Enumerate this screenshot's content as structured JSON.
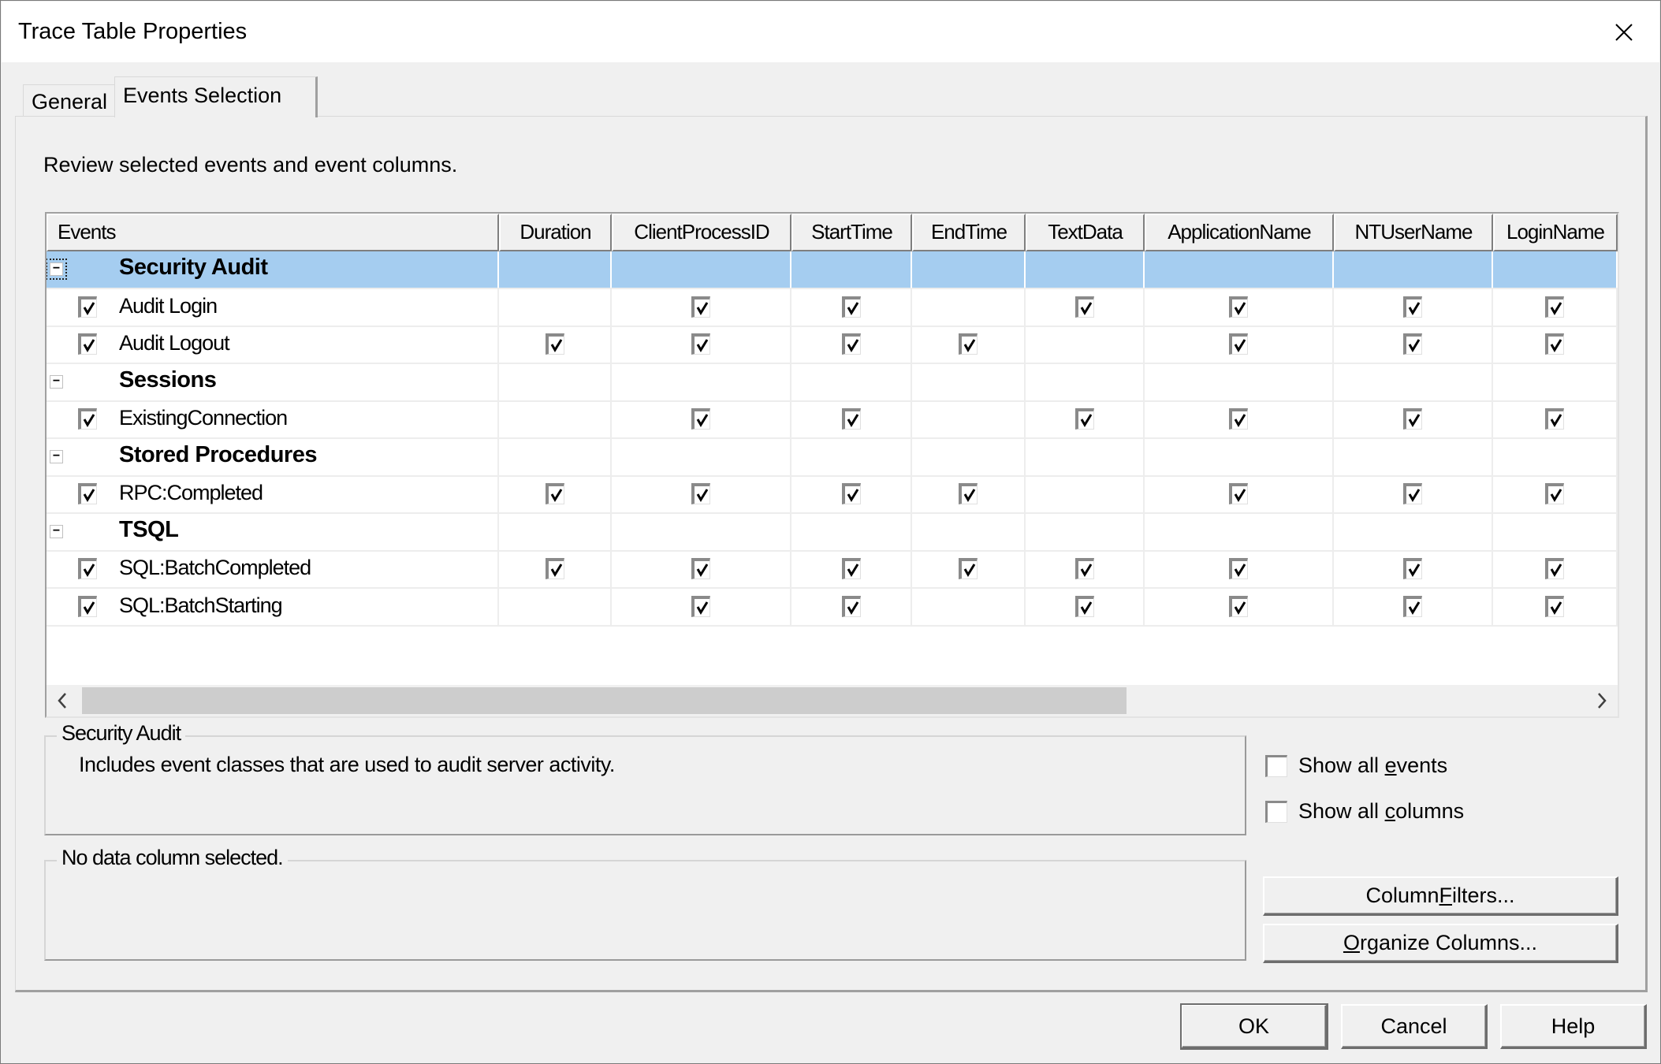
{
  "window": {
    "title": "Trace Table Properties",
    "close_icon": "close-x"
  },
  "tabs": [
    {
      "label": "General",
      "active": false
    },
    {
      "label": "Events Selection",
      "active": true
    }
  ],
  "instruction": "Review selected events and event columns.",
  "grid": {
    "columns": [
      "Events",
      "Duration",
      "ClientProcessID",
      "StartTime",
      "EndTime",
      "TextData",
      "ApplicationName",
      "NTUserName",
      "LoginName"
    ],
    "rows": [
      {
        "type": "category",
        "label": "Security Audit",
        "expanded": true,
        "selected": true
      },
      {
        "type": "event",
        "label": "Audit Login",
        "checked": true,
        "cols": [
          false,
          true,
          true,
          false,
          true,
          true,
          true,
          true
        ]
      },
      {
        "type": "event",
        "label": "Audit Logout",
        "checked": true,
        "cols": [
          true,
          true,
          true,
          true,
          false,
          true,
          true,
          true
        ]
      },
      {
        "type": "category",
        "label": "Sessions",
        "expanded": true,
        "selected": false
      },
      {
        "type": "event",
        "label": "ExistingConnection",
        "checked": true,
        "cols": [
          false,
          true,
          true,
          false,
          true,
          true,
          true,
          true
        ]
      },
      {
        "type": "category",
        "label": "Stored Procedures",
        "expanded": true,
        "selected": false
      },
      {
        "type": "event",
        "label": "RPC:Completed",
        "checked": true,
        "cols": [
          true,
          true,
          true,
          true,
          false,
          true,
          true,
          true
        ]
      },
      {
        "type": "category",
        "label": "TSQL",
        "expanded": true,
        "selected": false
      },
      {
        "type": "event",
        "label": "SQL:BatchCompleted",
        "checked": true,
        "cols": [
          true,
          true,
          true,
          true,
          true,
          true,
          true,
          true
        ]
      },
      {
        "type": "event",
        "label": "SQL:BatchStarting",
        "checked": true,
        "cols": [
          false,
          true,
          true,
          false,
          true,
          true,
          true,
          true
        ]
      }
    ],
    "selection_color": "#a5cdf0",
    "scroll_left_icon": "chevron-left",
    "scroll_right_icon": "chevron-right"
  },
  "description_box": {
    "title": "Security Audit",
    "text": "Includes event classes that are used to audit server activity."
  },
  "column_box": {
    "title": "No data column selected."
  },
  "options": {
    "show_all_events": {
      "pre": "Show all ",
      "mnemonic": "e",
      "post": "vents",
      "checked": false
    },
    "show_all_columns": {
      "pre": "Show all ",
      "mnemonic": "c",
      "post": "olumns",
      "checked": false
    }
  },
  "buttons": {
    "column_filters": {
      "pre": "Column ",
      "mnemonic": "F",
      "post": "ilters..."
    },
    "organize_columns": {
      "pre": "",
      "mnemonic": "O",
      "post": "rganize Columns..."
    },
    "ok": "OK",
    "cancel": "Cancel",
    "help": "Help"
  }
}
